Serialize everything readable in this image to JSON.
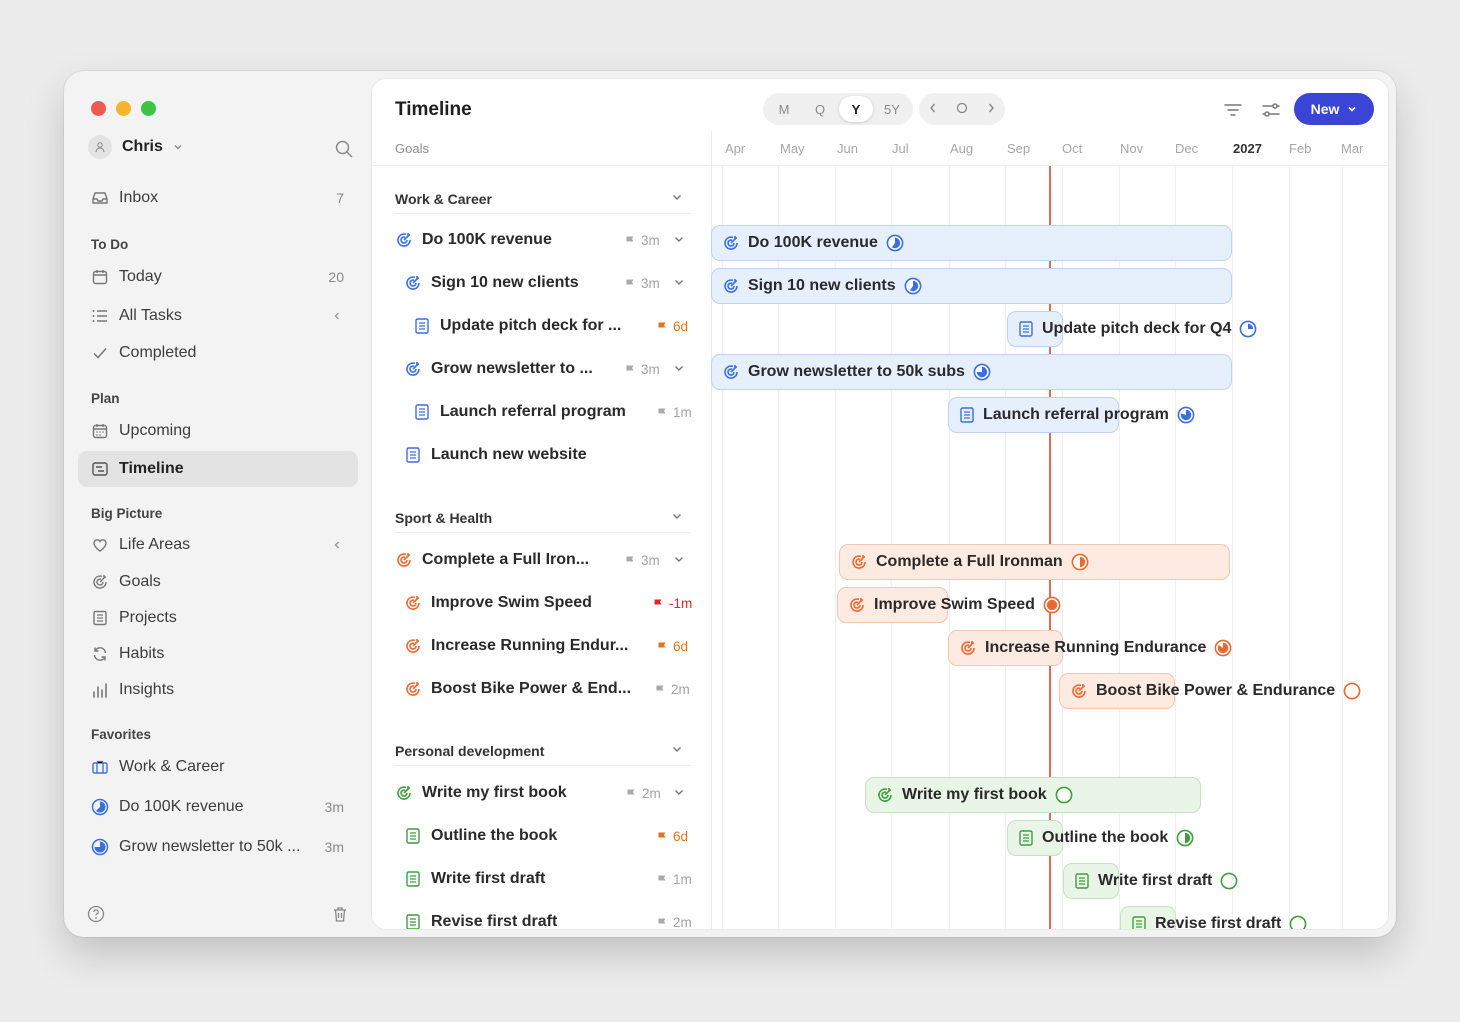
{
  "colors": {
    "blue": "#3b6fe0",
    "orange": "#e86a30",
    "green": "#3f9e3f",
    "accent": "#3a45d6",
    "today": "#e3685c"
  },
  "sidebar": {
    "user": "Chris",
    "inbox": {
      "label": "Inbox",
      "count": "7"
    },
    "todo_head": "To Do",
    "today": {
      "label": "Today",
      "count": "20"
    },
    "all_tasks": "All Tasks",
    "completed": "Completed",
    "plan_head": "Plan",
    "upcoming": "Upcoming",
    "timeline": "Timeline",
    "big_head": "Big Picture",
    "life_areas": "Life Areas",
    "goals": "Goals",
    "projects": "Projects",
    "habits": "Habits",
    "insights": "Insights",
    "fav_head": "Favorites",
    "fav1": "Work & Career",
    "fav2": {
      "label": "Do 100K revenue",
      "meta": "3m"
    },
    "fav3": {
      "label": "Grow newsletter to 50k ...",
      "meta": "3m"
    }
  },
  "main": {
    "title": "Timeline",
    "zoom": [
      "M",
      "Q",
      "Y",
      "5Y"
    ],
    "zoom_selected": "Y",
    "new_label": "New",
    "goals_head": "Goals",
    "months": [
      "Apr",
      "May",
      "Jun",
      "Jul",
      "Aug",
      "Sep",
      "Oct",
      "Nov",
      "Dec",
      "2027",
      "Feb",
      "Mar"
    ]
  },
  "list": {
    "groups": [
      "Work & Career",
      "Sport & Health",
      "Personal development"
    ],
    "rows": [
      {
        "label": "Do 100K revenue",
        "meta": "3m"
      },
      {
        "label": "Sign 10 new clients",
        "meta": "3m"
      },
      {
        "label": "Update pitch deck for ...",
        "meta": "6d"
      },
      {
        "label": "Grow newsletter to ...",
        "meta": "3m"
      },
      {
        "label": "Launch referral program",
        "meta": "1m"
      },
      {
        "label": "Launch new website",
        "meta": ""
      },
      {
        "label": "Complete a Full Iron...",
        "meta": "3m"
      },
      {
        "label": "Improve Swim Speed",
        "meta": "-1m"
      },
      {
        "label": "Increase Running Endur...",
        "meta": "6d"
      },
      {
        "label": "Boost Bike Power & End...",
        "meta": "2m"
      },
      {
        "label": "Write my first book",
        "meta": "2m"
      },
      {
        "label": "Outline the book",
        "meta": "6d"
      },
      {
        "label": "Write first draft",
        "meta": "1m"
      },
      {
        "label": "Revise first draft",
        "meta": "2m"
      }
    ]
  },
  "bars": [
    {
      "label": "Do 100K revenue",
      "progress": 0.6
    },
    {
      "label": "Sign 10 new clients",
      "progress": 0.6
    },
    {
      "label": "Update pitch deck for Q4",
      "progress": 0.25
    },
    {
      "label": "Grow newsletter to 50k subs",
      "progress": 0.75
    },
    {
      "label": "Launch referral program",
      "progress": 0.8
    },
    {
      "label": "Complete a Full Ironman",
      "progress": 0.5
    },
    {
      "label": "Improve Swim Speed",
      "progress": 1.0
    },
    {
      "label": "Increase Running Endurance",
      "progress": 0.85
    },
    {
      "label": "Boost Bike Power & Endurance",
      "progress": 0
    },
    {
      "label": "Write my first book",
      "progress": 0
    },
    {
      "label": "Outline the book",
      "progress": 0.5
    },
    {
      "label": "Write first draft",
      "progress": 0
    },
    {
      "label": "Revise first draft",
      "progress": 0
    }
  ]
}
